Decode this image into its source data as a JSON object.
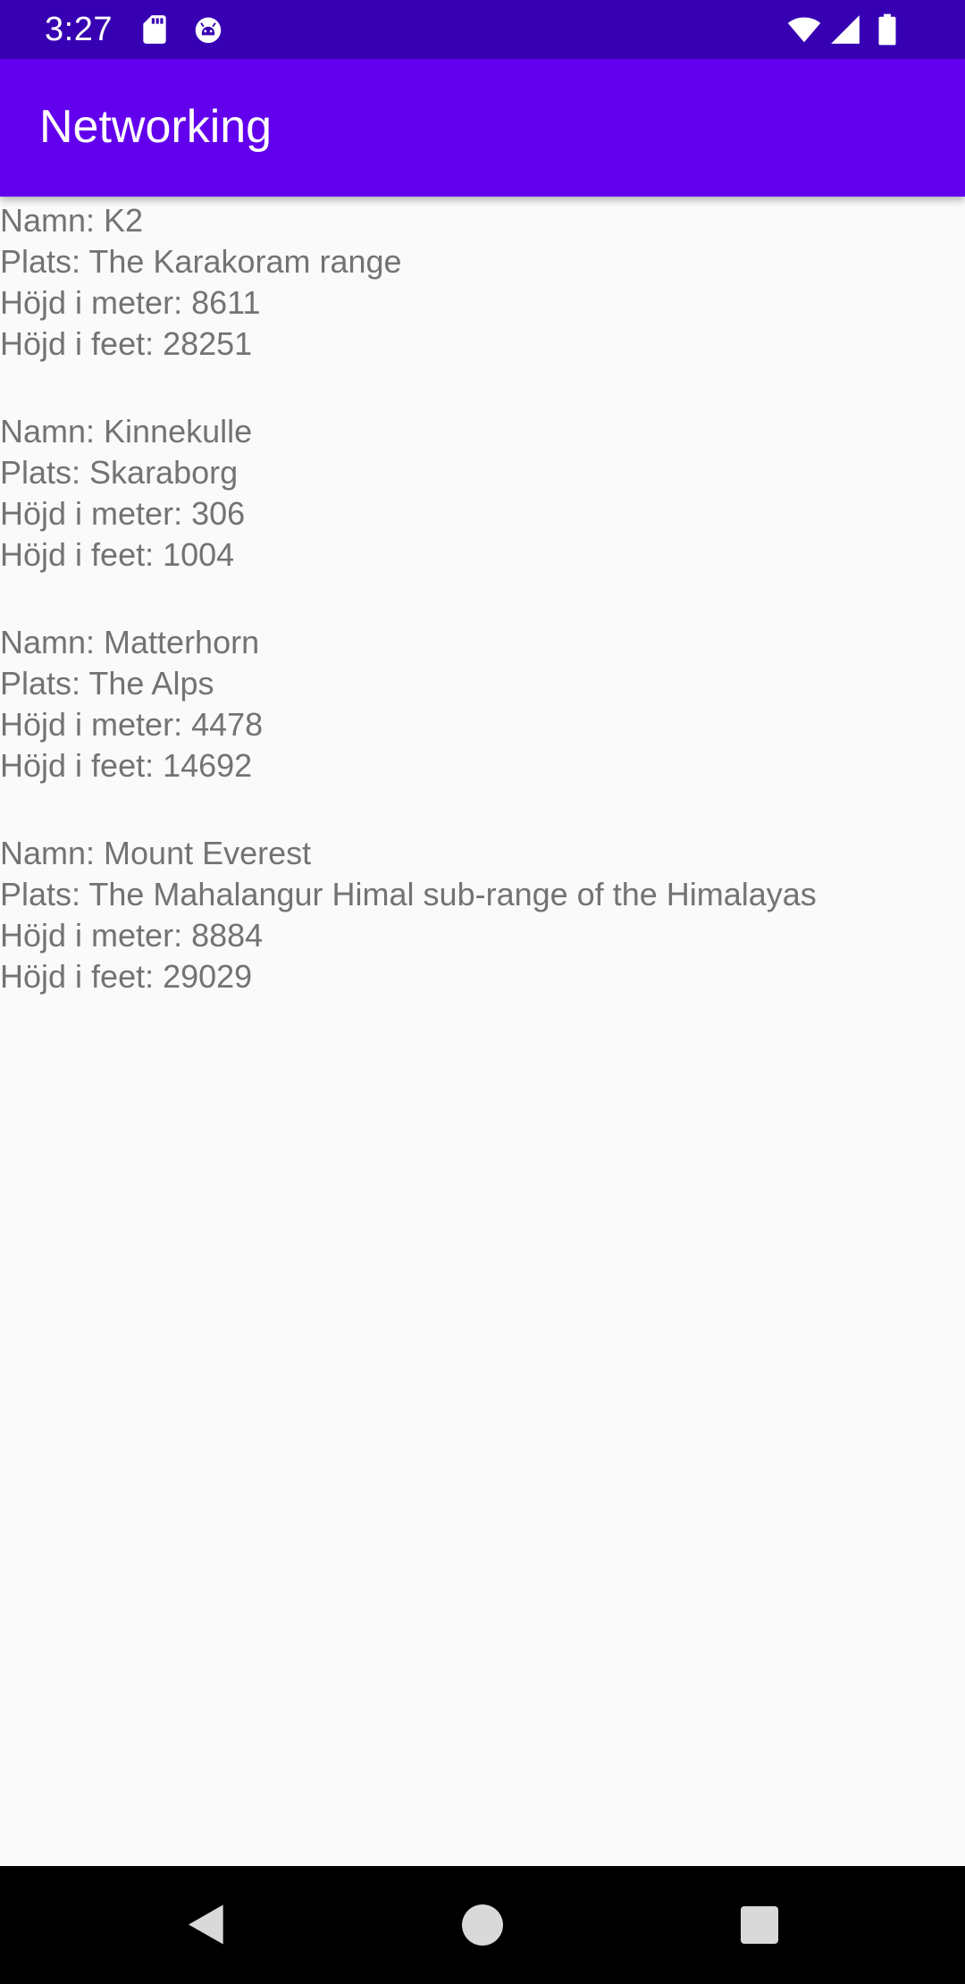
{
  "status_bar": {
    "time": "3:27",
    "icons": [
      "sd-card-icon",
      "android-debug-icon",
      "wifi-icon",
      "cellular-signal-icon",
      "battery-icon"
    ],
    "background": "#3700B3"
  },
  "app_bar": {
    "title": "Networking",
    "background": "#6200EE"
  },
  "mountains": [
    {
      "name": "Namn: K2",
      "location": "Plats: The Karakoram range",
      "height_meters": "Höjd i meter: 8611",
      "height_feet": "Höjd i feet: 28251"
    },
    {
      "name": "Namn: Kinnekulle",
      "location": "Plats: Skaraborg",
      "height_meters": "Höjd i meter: 306",
      "height_feet": "Höjd i feet: 1004"
    },
    {
      "name": "Namn: Matterhorn",
      "location": "Plats: The Alps",
      "height_meters": "Höjd i meter: 4478",
      "height_feet": "Höjd i feet: 14692"
    },
    {
      "name": "Namn: Mount Everest",
      "location": "Plats: The Mahalangur Himal sub-range of the Himalayas",
      "height_meters": "Höjd i meter: 8884",
      "height_feet": "Höjd i feet: 29029"
    }
  ],
  "nav_bar": {
    "buttons": [
      "back-icon",
      "home-icon",
      "recents-icon"
    ],
    "background": "#000000"
  }
}
